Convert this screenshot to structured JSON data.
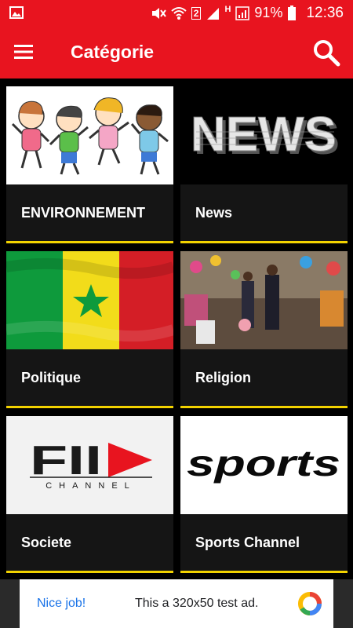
{
  "status": {
    "sim_number": "2",
    "network_type": "H",
    "battery": "91%",
    "time": "12:36"
  },
  "app_bar": {
    "title": "Catégorie"
  },
  "categories": [
    {
      "label": "ENVIRONNEMENT",
      "image": "cartoon-kids"
    },
    {
      "label": "News",
      "image": "news-lettering",
      "image_text": "NEWS"
    },
    {
      "label": "Politique",
      "image": "senegal-flag"
    },
    {
      "label": "Religion",
      "image": "ceremony-photo"
    },
    {
      "label": "Societe",
      "image": "fii-channel-logo",
      "image_text": "FII",
      "image_subtext": "CHANNEL"
    },
    {
      "label": "Sports Channel",
      "image": "sports-logo",
      "image_text": "sports"
    }
  ],
  "ad": {
    "nice": "Nice job!",
    "text": "This a 320x50 test ad."
  },
  "colors": {
    "primary": "#e8141f",
    "accent": "#f2d200",
    "card": "#151515"
  }
}
